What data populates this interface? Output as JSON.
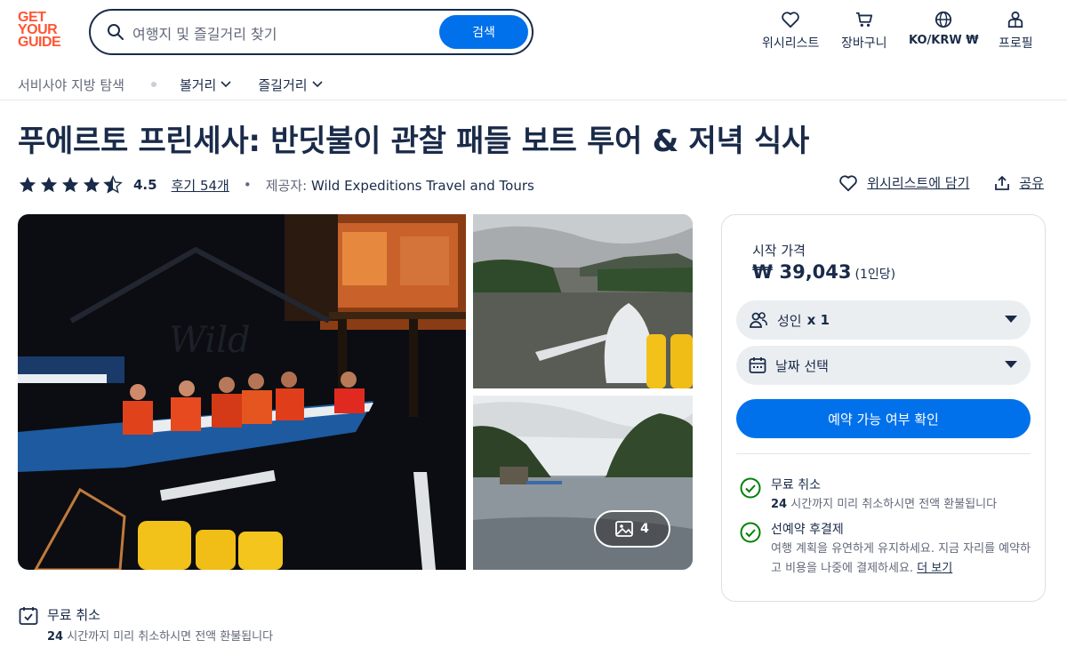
{
  "logo": {
    "lines": [
      "GET",
      "YOUR",
      "GUIDE"
    ]
  },
  "search": {
    "placeholder": "여행지 및 즐길거리 찾기",
    "button": "검색"
  },
  "header_nav": [
    {
      "label": "위시리스트",
      "icon": "heart-icon"
    },
    {
      "label": "장바구니",
      "icon": "cart-icon"
    },
    {
      "label": "KO/KRW ₩",
      "icon": "globe-icon"
    },
    {
      "label": "프로필",
      "icon": "profile-icon"
    }
  ],
  "subnav": {
    "location": "서비사야 지방 탐색",
    "items": [
      "볼거리",
      "즐길거리"
    ]
  },
  "activity": {
    "title": "푸에르토 프린세사: 반딧불이 관찰 패들 보트 투어 & 저녁 식사",
    "rating": "4.5",
    "rating_value": 4.5,
    "reviews": "후기 54개",
    "provider_label": "제공자:",
    "provider": "Wild Expeditions Travel and Tours",
    "wishlist_action": "위시리스트에 담기",
    "share_action": "공유"
  },
  "gallery": {
    "photo_count": "4"
  },
  "booking": {
    "from_label": "시작 가격",
    "price": "₩ 39,043",
    "per": "(1인당)",
    "participants_label": "성인",
    "participants_value": "x 1",
    "date_label": "날짜 선택",
    "cta": "예약 가능 여부 확인",
    "features": [
      {
        "title": "무료 취소",
        "desc_bold": "24",
        "desc": "시간까지 미리 취소하시면 전액 환불됩니다"
      },
      {
        "title": "선예약 후결제",
        "desc": "여행 계획을 유연하게 유지하세요. 지금 자리를 예약하고 비용을 나중에 결제하세요.",
        "link": "더 보기"
      }
    ]
  },
  "highlight": {
    "title": "무료 취소",
    "desc_bold": "24",
    "desc": "시간까지 미리 취소하시면 전액 환불됩니다"
  },
  "colors": {
    "brand_orange": "#ff5533",
    "primary_blue": "#0071eb",
    "text_navy": "#1a2b49",
    "success_green": "#008009"
  }
}
